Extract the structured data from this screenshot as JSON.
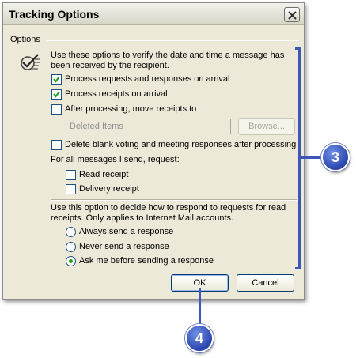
{
  "dialog": {
    "title": "Tracking Options",
    "group_label": "Options",
    "description": [
      "Use these options to verify the date and time a message has",
      "been received by the recipient."
    ],
    "checkboxes": [
      {
        "label": "Process requests and responses on arrival",
        "checked": true
      },
      {
        "label": "Process receipts on arrival",
        "checked": true
      },
      {
        "label": "After processing, move receipts to",
        "checked": false
      }
    ],
    "folder_field": {
      "value": "Deleted Items"
    },
    "browse_label": "Browse...",
    "delete_blank_label": "Delete blank voting and meeting responses after processing",
    "send_request_label": "For all messages I send, request:",
    "read_receipt_label": "Read receipt",
    "delivery_receipt_label": "Delivery receipt",
    "respond_info": [
      "Use this option to decide how to respond to requests for read",
      "receipts. Only applies to Internet Mail accounts."
    ],
    "radios": [
      {
        "label": "Always send a response",
        "selected": false
      },
      {
        "label": "Never send a response",
        "selected": false
      },
      {
        "label": "Ask me before sending a response",
        "selected": true
      }
    ],
    "ok_label": "OK",
    "cancel_label": "Cancel"
  },
  "callouts": {
    "first": "3",
    "second": "4"
  },
  "colors": {
    "callout": "#3d57b8",
    "dialog_bg": "#ece9d8"
  }
}
